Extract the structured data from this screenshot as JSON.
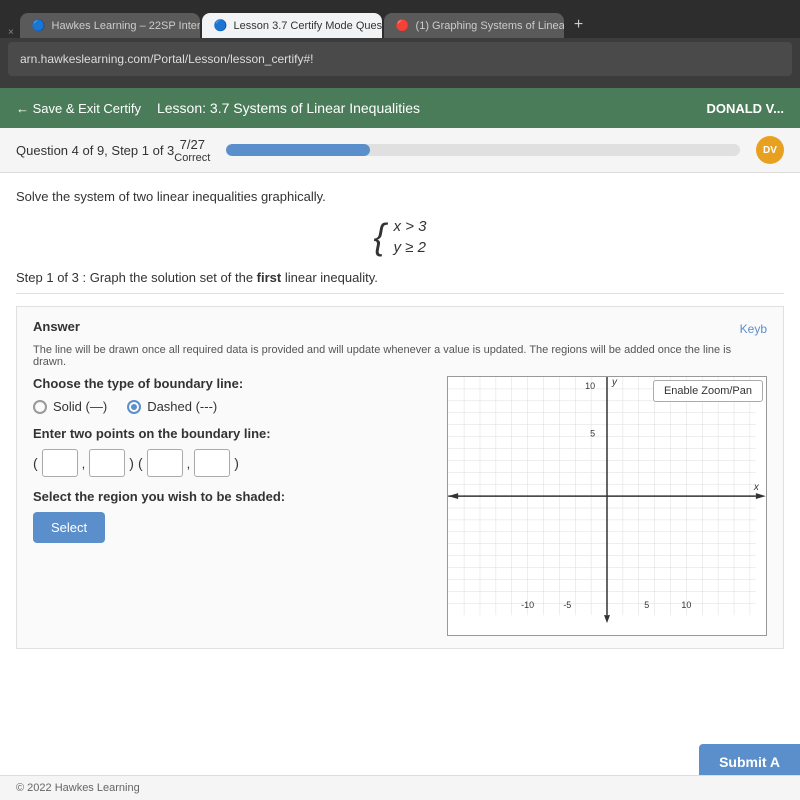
{
  "browser": {
    "tabs": [
      {
        "id": "tab1",
        "label": "Hawkes Learning – 22SP Inter...",
        "active": false,
        "icon": "🔵"
      },
      {
        "id": "tab2",
        "label": "Lesson 3.7 Certify Mode Ques...",
        "active": true,
        "icon": "🔵"
      },
      {
        "id": "tab3",
        "label": "(1) Graphing Systems of Linea...",
        "active": false,
        "icon": "🔴"
      }
    ],
    "address": "arn.hawkeslearning.com/Portal/Lesson/lesson_certify#!"
  },
  "nav": {
    "save_exit": "← Save & Exit Certify",
    "lesson_title": "Lesson: 3.7 Systems of Linear Inequalities",
    "user": "DONALD V..."
  },
  "question": {
    "info": "Question 4 of 9, Step 1 of 3",
    "score_fraction": "7/27",
    "score_label": "Correct",
    "progress_percent": 28
  },
  "problem": {
    "statement": "Solve the system of two linear inequalities graphically.",
    "equation1": "x > 3",
    "equation2": "y ≥ 2",
    "step": "Step 1 of 3 :",
    "step_instruction": " Graph the solution set of the ",
    "step_emphasis": "first",
    "step_end": " linear inequality."
  },
  "answer": {
    "label": "Answer",
    "keyboard_hint": "Keyb",
    "info_text": "The line will be drawn once all required data is provided and will update whenever a value is updated. The regions will be added once the line is drawn.",
    "zoom_pan": "Enable Zoom/Pan",
    "boundary": {
      "label": "Choose the type of boundary line:",
      "solid_label": "Solid (—)",
      "dashed_label": "Dashed (---)",
      "selected": "dashed"
    },
    "points": {
      "label": "Enter two points on the boundary line:",
      "p1x": "",
      "p1y": "",
      "p2x": "",
      "p2y": ""
    },
    "region": {
      "label": "Select the region you wish to be shaded:",
      "button_label": "Select"
    }
  },
  "graph": {
    "x_min": -10,
    "x_max": 10,
    "y_min": -10,
    "y_max": 10,
    "x_labels": [
      "-10",
      "-5",
      "5",
      "10"
    ],
    "y_labels": [
      "10",
      "5"
    ]
  },
  "footer": {
    "text": "© 2022 Hawkes Learning"
  },
  "submit": {
    "label": "Submit A"
  }
}
